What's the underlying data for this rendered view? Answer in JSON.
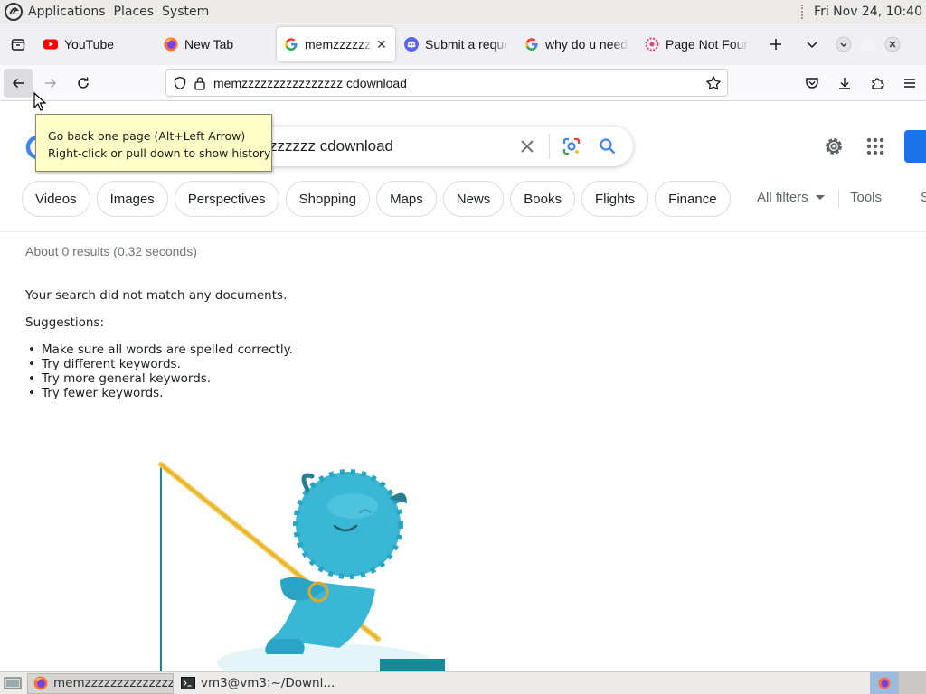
{
  "top_panel": {
    "menus": [
      "Applications",
      "Places",
      "System"
    ],
    "clock": "Fri Nov 24, 10:40"
  },
  "tabs": [
    {
      "title": "YouTube",
      "icon": "youtube-icon"
    },
    {
      "title": "New Tab",
      "icon": "firefox-icon"
    },
    {
      "title": "memzzzzzzzzzzzzzzzz cdownload",
      "icon": "google-icon",
      "active": true
    },
    {
      "title": "Submit a request",
      "icon": "discord-icon"
    },
    {
      "title": "why do u need",
      "icon": "google-icon"
    },
    {
      "title": "Page Not Found",
      "icon": "page-icon"
    }
  ],
  "navbar": {
    "url": "memzzzzzzzzzzzzzzzz cdownload"
  },
  "tooltip": {
    "line1": "Go back one page (Alt+Left Arrow)",
    "line2": "Right-click or pull down to show history"
  },
  "search": {
    "query": "zzzzzz cdownload"
  },
  "chips": [
    "Videos",
    "Images",
    "Perspectives",
    "Shopping",
    "Maps",
    "News",
    "Books",
    "Flights",
    "Finance"
  ],
  "filters": {
    "all_filters": "All filters",
    "tools": "Tools",
    "cut_label": "S"
  },
  "results": {
    "stats": "About 0 results (0.32 seconds)",
    "no_match": "Your search did not match any documents.",
    "suggestions_title": "Suggestions:",
    "suggestions": [
      "Make sure all words are spelled correctly.",
      "Try different keywords.",
      "Try more general keywords.",
      "Try fewer keywords."
    ]
  },
  "taskbar": {
    "items": [
      {
        "title": "memzzzzzzzzzzzzzzzz...",
        "icon": "firefox-icon",
        "active": true
      },
      {
        "title": "vm3@vm3:~/Downl...",
        "icon": "terminal-icon"
      }
    ]
  },
  "colors": {
    "google_blue": "#1a73e8",
    "tooltip_bg": "#ffffc8",
    "yeti": "#3ab7d5"
  }
}
